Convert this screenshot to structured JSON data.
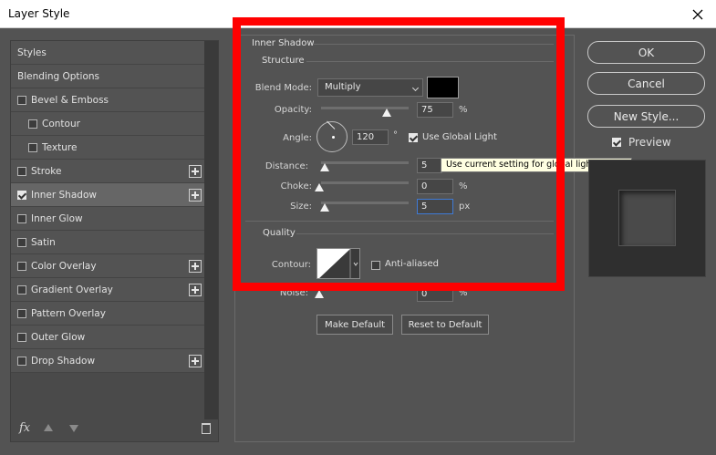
{
  "window": {
    "title": "Layer Style"
  },
  "styles_list": {
    "items": [
      {
        "label": "Styles",
        "checkbox": false,
        "checked": false,
        "indent": 0,
        "plus": false,
        "selected": false
      },
      {
        "label": "Blending Options",
        "checkbox": false,
        "checked": false,
        "indent": 0,
        "plus": false,
        "selected": false
      },
      {
        "label": "Bevel & Emboss",
        "checkbox": true,
        "checked": false,
        "indent": 0,
        "plus": false,
        "selected": false
      },
      {
        "label": "Contour",
        "checkbox": true,
        "checked": false,
        "indent": 1,
        "plus": false,
        "selected": false
      },
      {
        "label": "Texture",
        "checkbox": true,
        "checked": false,
        "indent": 1,
        "plus": false,
        "selected": false
      },
      {
        "label": "Stroke",
        "checkbox": true,
        "checked": false,
        "indent": 0,
        "plus": true,
        "selected": false
      },
      {
        "label": "Inner Shadow",
        "checkbox": true,
        "checked": true,
        "indent": 0,
        "plus": true,
        "selected": true
      },
      {
        "label": "Inner Glow",
        "checkbox": true,
        "checked": false,
        "indent": 0,
        "plus": false,
        "selected": false
      },
      {
        "label": "Satin",
        "checkbox": true,
        "checked": false,
        "indent": 0,
        "plus": false,
        "selected": false
      },
      {
        "label": "Color Overlay",
        "checkbox": true,
        "checked": false,
        "indent": 0,
        "plus": true,
        "selected": false
      },
      {
        "label": "Gradient Overlay",
        "checkbox": true,
        "checked": false,
        "indent": 0,
        "plus": true,
        "selected": false
      },
      {
        "label": "Pattern Overlay",
        "checkbox": true,
        "checked": false,
        "indent": 0,
        "plus": false,
        "selected": false
      },
      {
        "label": "Outer Glow",
        "checkbox": true,
        "checked": false,
        "indent": 0,
        "plus": false,
        "selected": false
      },
      {
        "label": "Drop Shadow",
        "checkbox": true,
        "checked": false,
        "indent": 0,
        "plus": true,
        "selected": false
      }
    ],
    "footer": {
      "fx_label": "fx"
    }
  },
  "inner_shadow": {
    "section_title": "Inner Shadow",
    "structure": {
      "title": "Structure",
      "blend_mode_label": "Blend Mode:",
      "blend_mode_value": "Multiply",
      "shadow_color": "#000000",
      "opacity_label": "Opacity:",
      "opacity_value": "75",
      "opacity_unit": "%",
      "opacity_level": 0.75,
      "angle_label": "Angle:",
      "angle_value": "120",
      "angle_unit": "°",
      "use_global_light_label": "Use Global Light",
      "use_global_light_checked": true,
      "distance_label": "Distance:",
      "distance_value": "5",
      "choke_label": "Choke:",
      "choke_value": "0",
      "choke_unit": "%",
      "size_label": "Size:",
      "size_value": "5",
      "size_unit": "px",
      "tooltip": "Use current setting for global light source"
    },
    "quality": {
      "title": "Quality",
      "contour_label": "Contour:",
      "anti_aliased_label": "Anti-aliased",
      "noise_label": "Noise:",
      "noise_value": "0",
      "noise_unit": "%"
    },
    "make_default_label": "Make Default",
    "reset_default_label": "Reset to Default"
  },
  "actions": {
    "ok_label": "OK",
    "cancel_label": "Cancel",
    "new_style_label": "New Style...",
    "preview_label": "Preview",
    "preview_checked": true
  },
  "colors": {
    "highlight": "#ff0000",
    "panel_bg": "#535353"
  }
}
